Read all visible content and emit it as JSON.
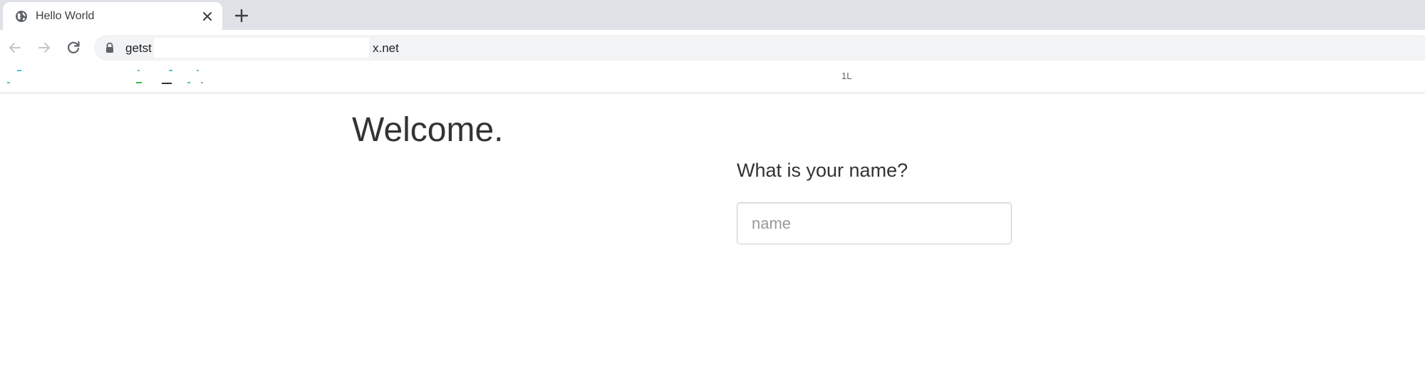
{
  "browser": {
    "tab": {
      "title": "Hello World",
      "favicon": "globe-icon"
    },
    "url": {
      "prefix": "getst",
      "suffix": "x.net",
      "secure_icon": "lock-icon"
    },
    "bookmarks": {
      "visible_text": "1L"
    }
  },
  "page": {
    "heading": "Welcome.",
    "question": "What is your name?",
    "name_input": {
      "placeholder": "name",
      "value": ""
    }
  },
  "colors": {
    "tabstrip_bg": "#dee1e6",
    "omnibox_bg": "#f1f3f4",
    "text_primary": "#333333",
    "input_border": "#cccccc",
    "placeholder": "#999999"
  }
}
